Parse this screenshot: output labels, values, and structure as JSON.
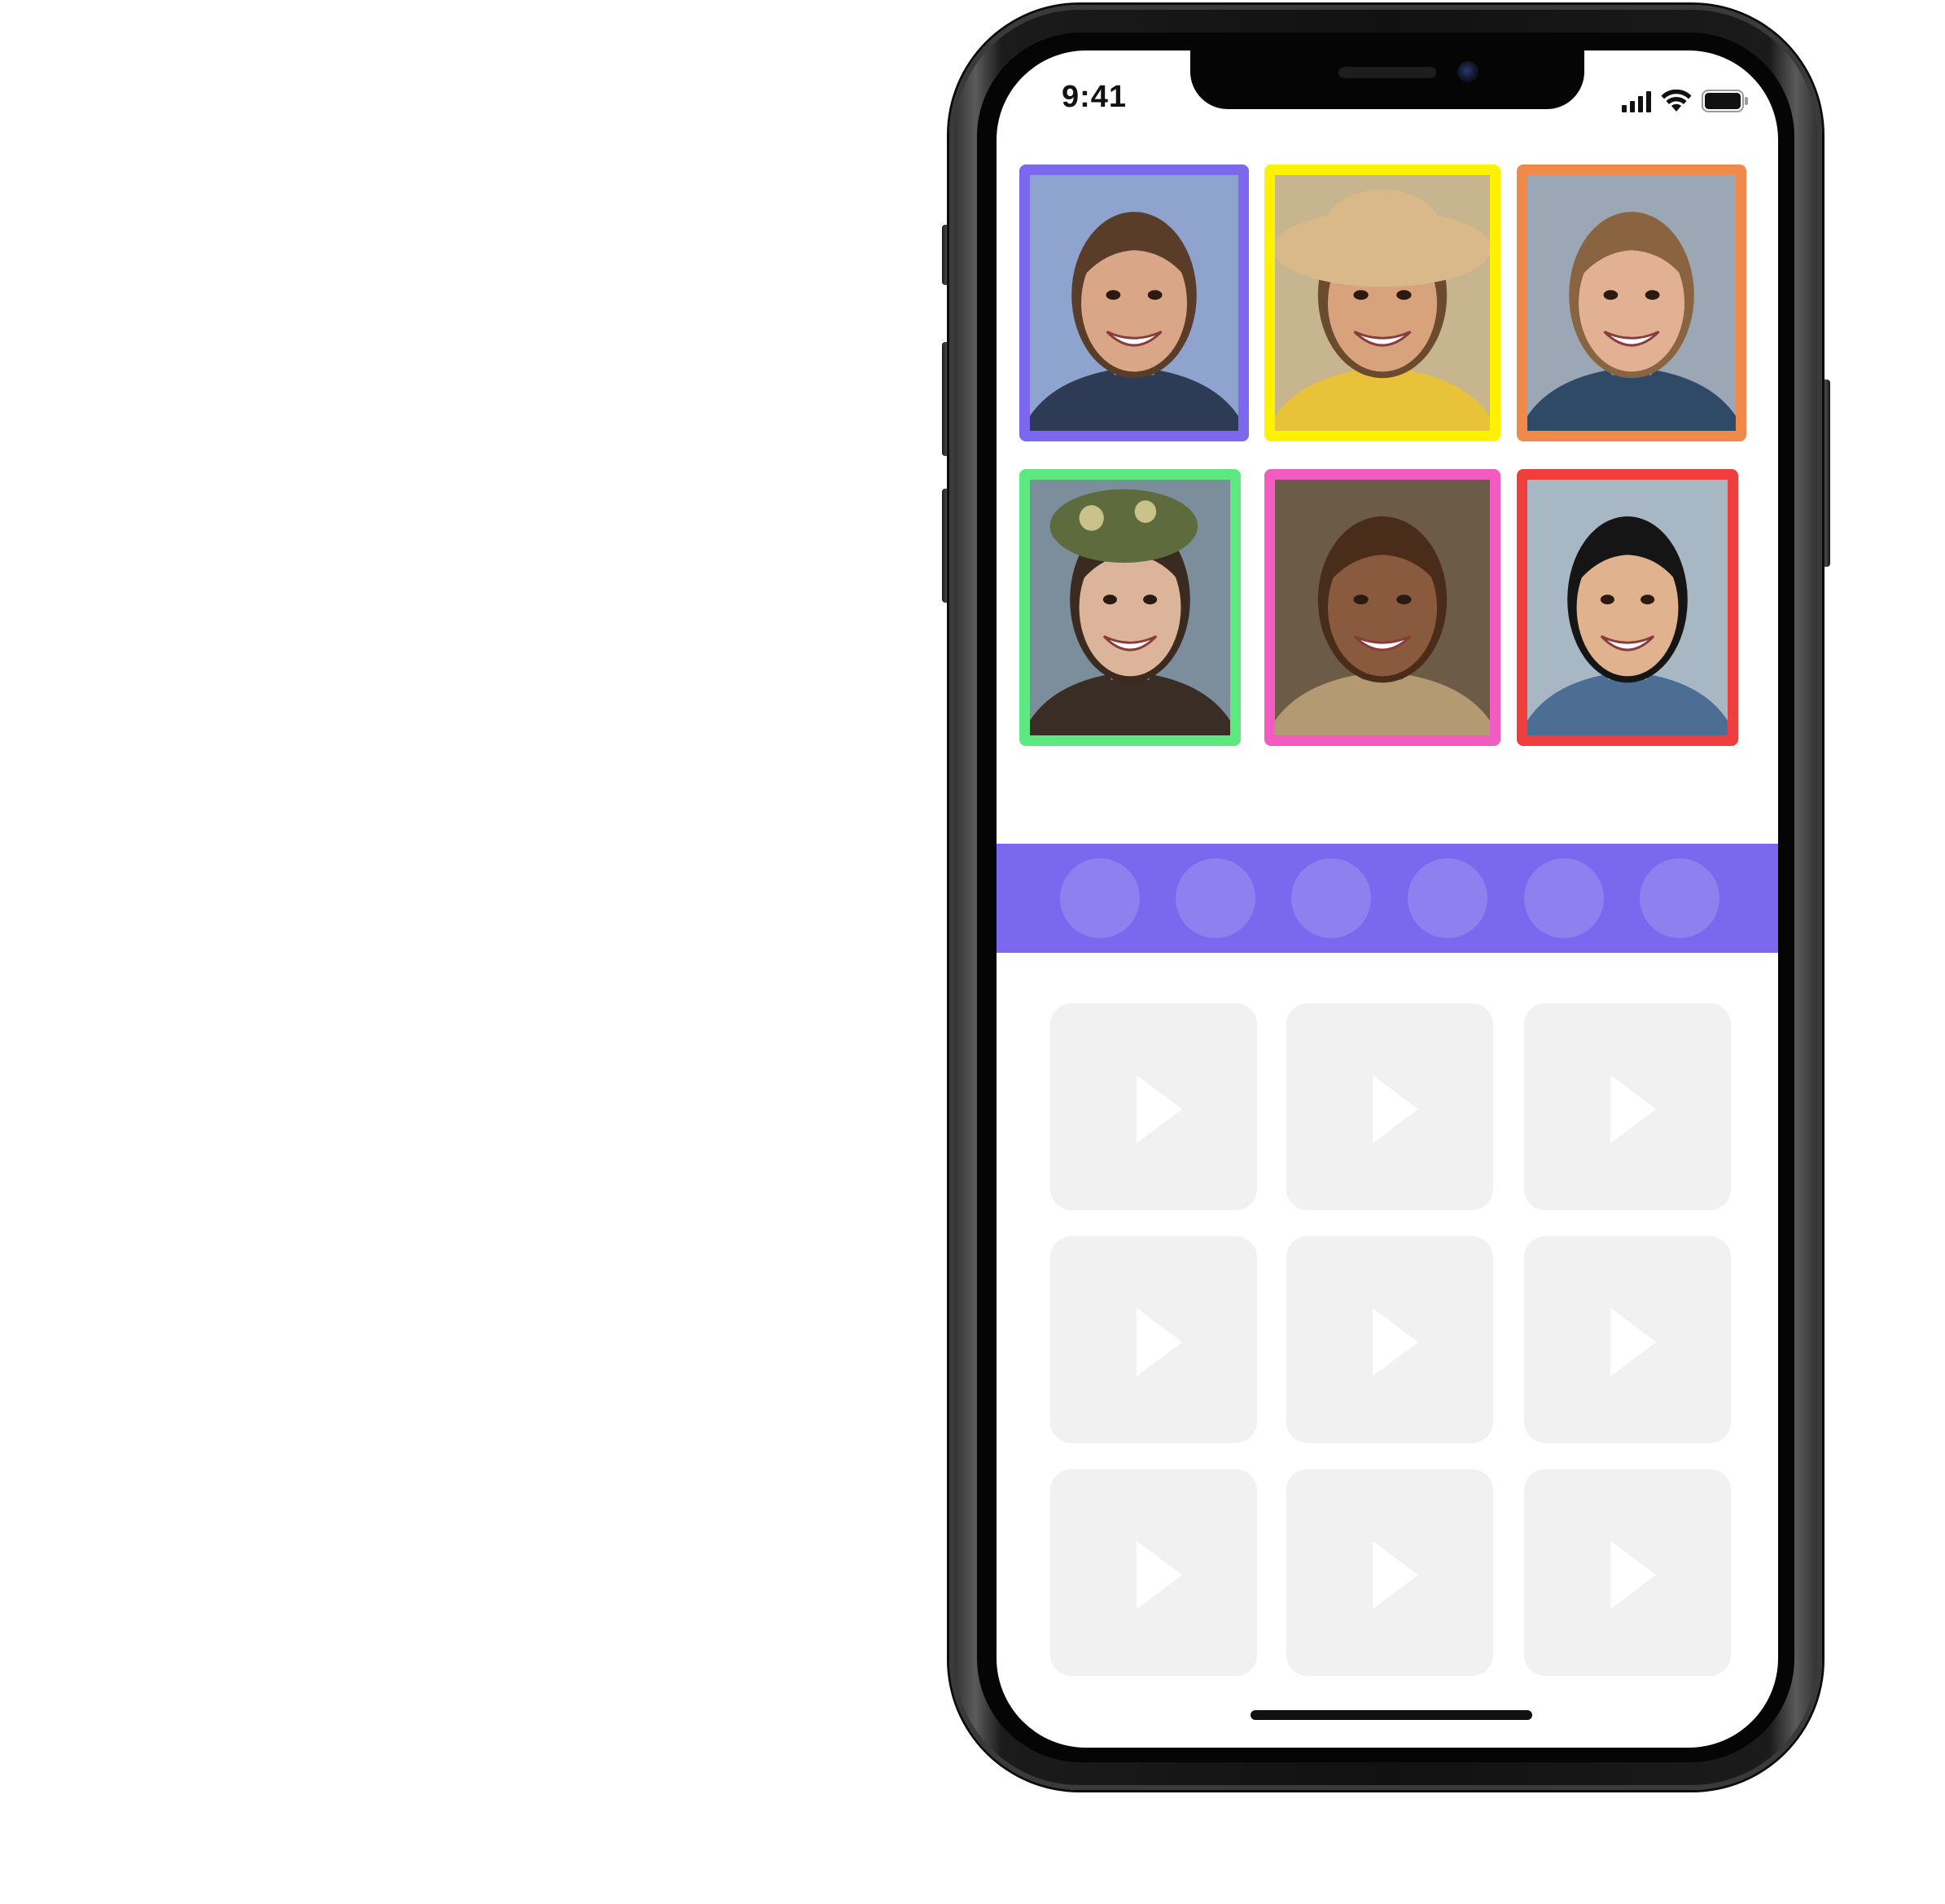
{
  "status_bar": {
    "time": "9:41",
    "icons": [
      "cellular-signal-icon",
      "wifi-icon",
      "battery-icon"
    ]
  },
  "participants": [
    {
      "id": "p1",
      "border_color": "#7b68ee",
      "skin": "#d9a787",
      "hair": "#5a3d28",
      "bg": "#8fa3cf",
      "shirt": "#2e3b57"
    },
    {
      "id": "p2",
      "border_color": "#fff200",
      "skin": "#d8a27c",
      "hair": "#6b4b2e",
      "bg": "#c7b58f",
      "shirt": "#e8c33a",
      "hat": "#d9b889"
    },
    {
      "id": "p3",
      "border_color": "#f08a4b",
      "skin": "#e2b092",
      "hair": "#8a6440",
      "bg": "#9ba7b4",
      "shirt": "#2f4a66"
    },
    {
      "id": "p4",
      "border_color": "#5ee882",
      "skin": "#dcb49a",
      "hair": "#3b2a20",
      "bg": "#7c8e9c",
      "shirt": "#3a2d26",
      "headwrap": "#5d6b3d"
    },
    {
      "id": "p5",
      "border_color": "#f25bc0",
      "skin": "#8a5a3e",
      "hair": "#4a2c1a",
      "bg": "#6c5b47",
      "shirt": "#b49a73"
    },
    {
      "id": "p6",
      "border_color": "#ee3e3e",
      "skin": "#e0b28e",
      "hair": "#151515",
      "bg": "#a8b7c4",
      "shirt": "#4c6e94"
    }
  ],
  "reaction_bar": {
    "color": "#7b68ee",
    "dot_color": "#8f80ef",
    "dot_count": 6
  },
  "videos": {
    "rows": 3,
    "cols": 3,
    "placeholder_color": "#f1f1f1",
    "icon": "play-icon"
  }
}
